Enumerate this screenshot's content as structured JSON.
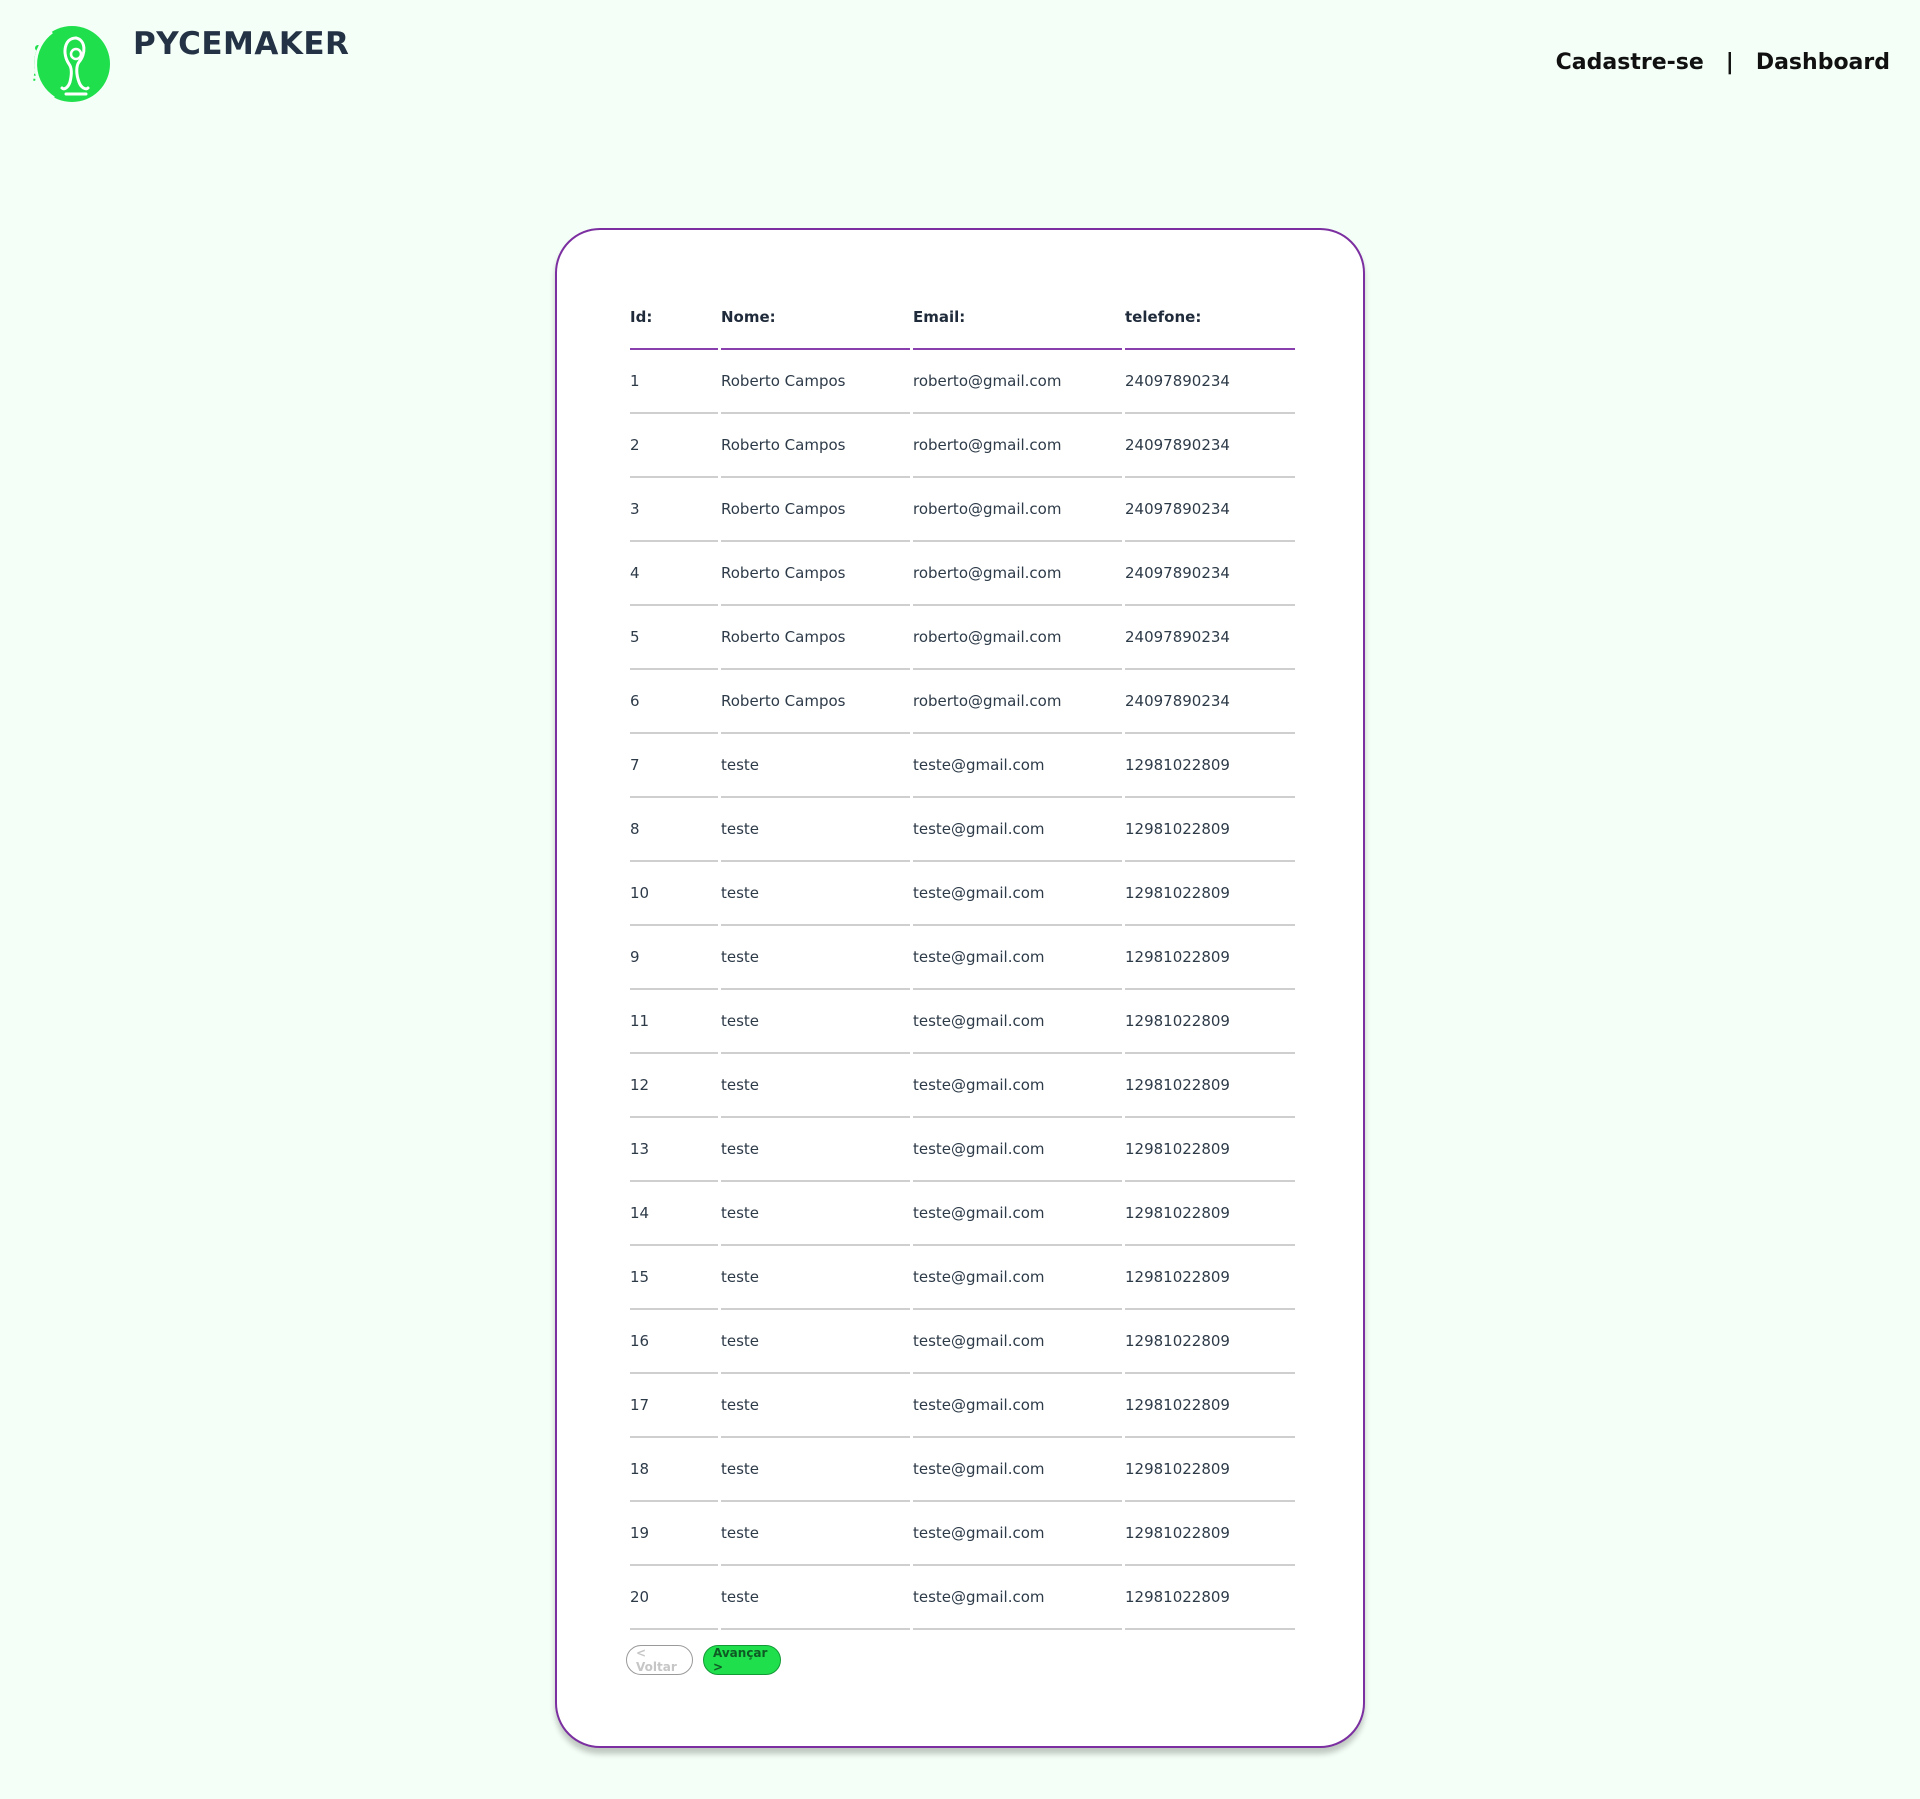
{
  "header": {
    "brand": "PYCEMAKER",
    "nav": {
      "signup": "Cadastre-se",
      "separator": "|",
      "dashboard": "Dashboard"
    }
  },
  "colors": {
    "background": "#f4fff7",
    "accent_green": "#1fe04c",
    "accent_purple": "#7b2fa0",
    "text_dark": "#233244"
  },
  "table": {
    "headers": {
      "id": "Id:",
      "nome": "Nome:",
      "email": "Email:",
      "telefone": "telefone:"
    },
    "rows": [
      {
        "id": "1",
        "nome": "Roberto Campos",
        "email": "roberto@gmail.com",
        "telefone": "24097890234"
      },
      {
        "id": "2",
        "nome": "Roberto Campos",
        "email": "roberto@gmail.com",
        "telefone": "24097890234"
      },
      {
        "id": "3",
        "nome": "Roberto Campos",
        "email": "roberto@gmail.com",
        "telefone": "24097890234"
      },
      {
        "id": "4",
        "nome": "Roberto Campos",
        "email": "roberto@gmail.com",
        "telefone": "24097890234"
      },
      {
        "id": "5",
        "nome": "Roberto Campos",
        "email": "roberto@gmail.com",
        "telefone": "24097890234"
      },
      {
        "id": "6",
        "nome": "Roberto Campos",
        "email": "roberto@gmail.com",
        "telefone": "24097890234"
      },
      {
        "id": "7",
        "nome": "teste",
        "email": "teste@gmail.com",
        "telefone": "12981022809"
      },
      {
        "id": "8",
        "nome": "teste",
        "email": "teste@gmail.com",
        "telefone": "12981022809"
      },
      {
        "id": "10",
        "nome": "teste",
        "email": "teste@gmail.com",
        "telefone": "12981022809"
      },
      {
        "id": "9",
        "nome": "teste",
        "email": "teste@gmail.com",
        "telefone": "12981022809"
      },
      {
        "id": "11",
        "nome": "teste",
        "email": "teste@gmail.com",
        "telefone": "12981022809"
      },
      {
        "id": "12",
        "nome": "teste",
        "email": "teste@gmail.com",
        "telefone": "12981022809"
      },
      {
        "id": "13",
        "nome": "teste",
        "email": "teste@gmail.com",
        "telefone": "12981022809"
      },
      {
        "id": "14",
        "nome": "teste",
        "email": "teste@gmail.com",
        "telefone": "12981022809"
      },
      {
        "id": "15",
        "nome": "teste",
        "email": "teste@gmail.com",
        "telefone": "12981022809"
      },
      {
        "id": "16",
        "nome": "teste",
        "email": "teste@gmail.com",
        "telefone": "12981022809"
      },
      {
        "id": "17",
        "nome": "teste",
        "email": "teste@gmail.com",
        "telefone": "12981022809"
      },
      {
        "id": "18",
        "nome": "teste",
        "email": "teste@gmail.com",
        "telefone": "12981022809"
      },
      {
        "id": "19",
        "nome": "teste",
        "email": "teste@gmail.com",
        "telefone": "12981022809"
      },
      {
        "id": "20",
        "nome": "teste",
        "email": "teste@gmail.com",
        "telefone": "12981022809"
      }
    ]
  },
  "pagination": {
    "prev_label": "< Voltar",
    "next_label": "Avançar >"
  }
}
